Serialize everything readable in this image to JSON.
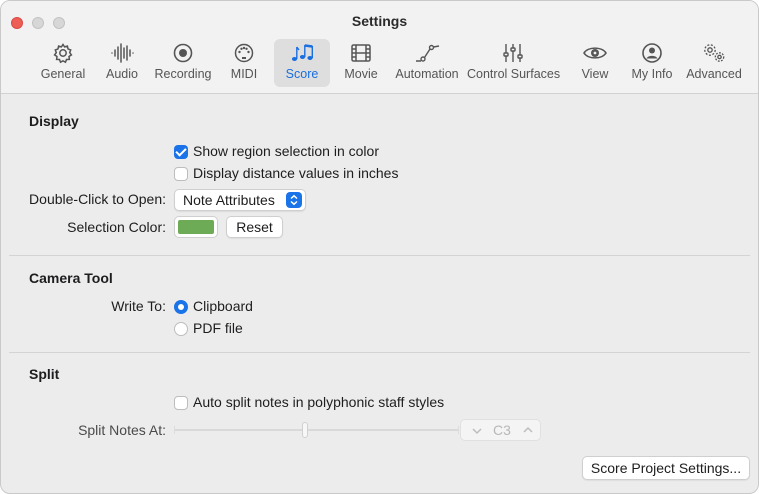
{
  "window": {
    "title": "Settings"
  },
  "toolbar": {
    "tabs": [
      {
        "label": "General",
        "icon": "gear-icon"
      },
      {
        "label": "Audio",
        "icon": "waveform-icon"
      },
      {
        "label": "Recording",
        "icon": "record-icon"
      },
      {
        "label": "MIDI",
        "icon": "midi-port-icon"
      },
      {
        "label": "Score",
        "icon": "music-notes-icon",
        "active": true
      },
      {
        "label": "Movie",
        "icon": "film-icon"
      },
      {
        "label": "Automation",
        "icon": "automation-curve-icon"
      },
      {
        "label": "Control Surfaces",
        "icon": "faders-icon"
      },
      {
        "label": "View",
        "icon": "eye-icon"
      },
      {
        "label": "My Info",
        "icon": "person-icon"
      },
      {
        "label": "Advanced",
        "icon": "gears-icon"
      }
    ]
  },
  "display": {
    "title": "Display",
    "show_region_selection": {
      "label": "Show region selection in color",
      "checked": true
    },
    "distance_inches": {
      "label": "Display distance values in inches",
      "checked": false
    },
    "double_click_label": "Double-Click to Open:",
    "double_click_value": "Note Attributes",
    "selection_color_label": "Selection Color:",
    "selection_color": "#6dab57",
    "reset_label": "Reset"
  },
  "camera": {
    "title": "Camera Tool",
    "write_to_label": "Write To:",
    "options": [
      {
        "label": "Clipboard",
        "selected": true
      },
      {
        "label": "PDF file",
        "selected": false
      }
    ]
  },
  "split": {
    "title": "Split",
    "auto_split": {
      "label": "Auto split notes in polyphonic staff styles",
      "checked": false
    },
    "split_notes_label": "Split Notes At:",
    "split_value": "C3",
    "slider_position": 0.46
  },
  "footer": {
    "score_project_settings": "Score Project Settings..."
  },
  "colors": {
    "accent": "#1a73e8",
    "active_tab_text": "#1a6fe0"
  }
}
